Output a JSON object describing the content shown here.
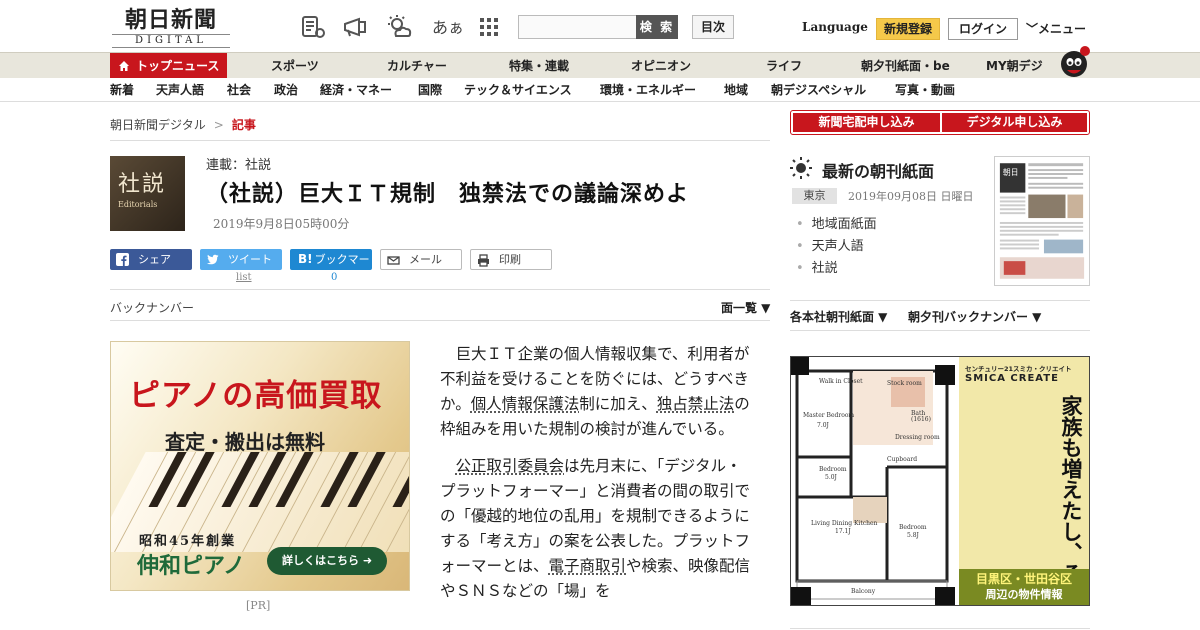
{
  "header": {
    "logo_main": "朝日新聞",
    "logo_sub": "DIGITAL",
    "icons": [
      "newspaper-icon",
      "megaphone-icon",
      "weather-icon",
      "text-size-icon",
      "grid-menu-icon"
    ],
    "text_size_label": "あぁ",
    "search_placeholder": "",
    "search_button": "検 索",
    "toc_button": "目次",
    "language": "Language",
    "register": "新規登録",
    "login": "ログイン",
    "menu": "メニュー"
  },
  "nav_main": [
    "トップニュース",
    "スポーツ",
    "カルチャー",
    "特集・連載",
    "オピニオン",
    "ライフ",
    "朝夕刊紙面・be",
    "MY朝デジ"
  ],
  "nav_sub": [
    "新着",
    "天声人語",
    "社会",
    "政治",
    "経済・マネー",
    "国際",
    "テック＆サイエンス",
    "環境・エネルギー",
    "地域",
    "朝デジスペシャル",
    "写真・動画"
  ],
  "breadcrumb": {
    "home": "朝日新聞デジタル",
    "sep": ">",
    "current": "記事"
  },
  "article": {
    "series": "連載：社説",
    "title": "（社説）巨大ＩＴ規制　独禁法での議論深めよ",
    "date": "2019年9月8日05時00分",
    "thumb_text": "社説",
    "thumb_sub": "Editorials",
    "paragraphs": [
      [
        "巨大ＩＴ企業の個人情報収集で、利用者が不利益を受けることを防ぐには、どうすべきか。",
        "個人情報保護法",
        "制に加え、",
        "独占禁止法",
        "の枠組みを用いた規制の検討が進んでいる。"
      ],
      [
        "",
        "公正取引委員会",
        "は先月末に、「デジタル・プラットフォーマー」と消費者の間の取引での「優越的地位の乱用」を規制できるようにする「考え方」の案を公表した。プラットフォーマーとは、",
        "電子商取引",
        "や検索、映像配信やＳＮＳなどの「場」を"
      ]
    ]
  },
  "share": {
    "facebook": "シェア",
    "twitter": "ツイート",
    "twitter_count": "list",
    "hatena": "ブックマーク",
    "hatena_count": "0",
    "mail": "メール",
    "print": "印刷"
  },
  "backnumber": "バックナンバー",
  "menu_list": "面一覧 ▼",
  "ad_left": {
    "headline": "ピアノの高価買取",
    "sub": "査定・搬出は無料",
    "since": "昭和45年創業",
    "name": "伸和ピアノ",
    "button": "詳しくはこちら",
    "pr": "[PR]"
  },
  "right": {
    "subscribe_paper": "新聞宅配申し込み",
    "subscribe_digital": "デジタル申し込み",
    "morning_title": "最新の朝刊紙面",
    "region": "東京",
    "paper_date": "2019年09月08日 日曜日",
    "links": [
      "地域面紙面",
      "天声人語",
      "社説"
    ],
    "paper_menu_1": "各本社朝刊紙面 ▼",
    "paper_menu_2": "朝夕刊バックナンバー ▼"
  },
  "ad_right": {
    "brand": "センチュリー21スミカ・クリエイト",
    "brand_en": "SMICA CREATE",
    "copy": "家族も増えたし、そろそろ一戸建て購入を検討してみようか。",
    "area": "目黒区・世田谷区",
    "area_sub": "周辺の物件情報",
    "plan_labels": [
      "Walk in Closet",
      "Master Bedroom",
      "Bedroom",
      "Living Dining Kitchen",
      "Bedroom",
      "Balcony",
      "Stock room",
      "Bath",
      "Dressing room",
      "Cupboard"
    ],
    "plan_values": [
      "7.0J",
      "5.0J",
      "17.1J",
      "5.8J",
      "(1616)"
    ]
  },
  "colors": {
    "brand_red": "#c8161d",
    "register_yellow": "#f5c94a",
    "ad_green": "#1f5a33"
  }
}
